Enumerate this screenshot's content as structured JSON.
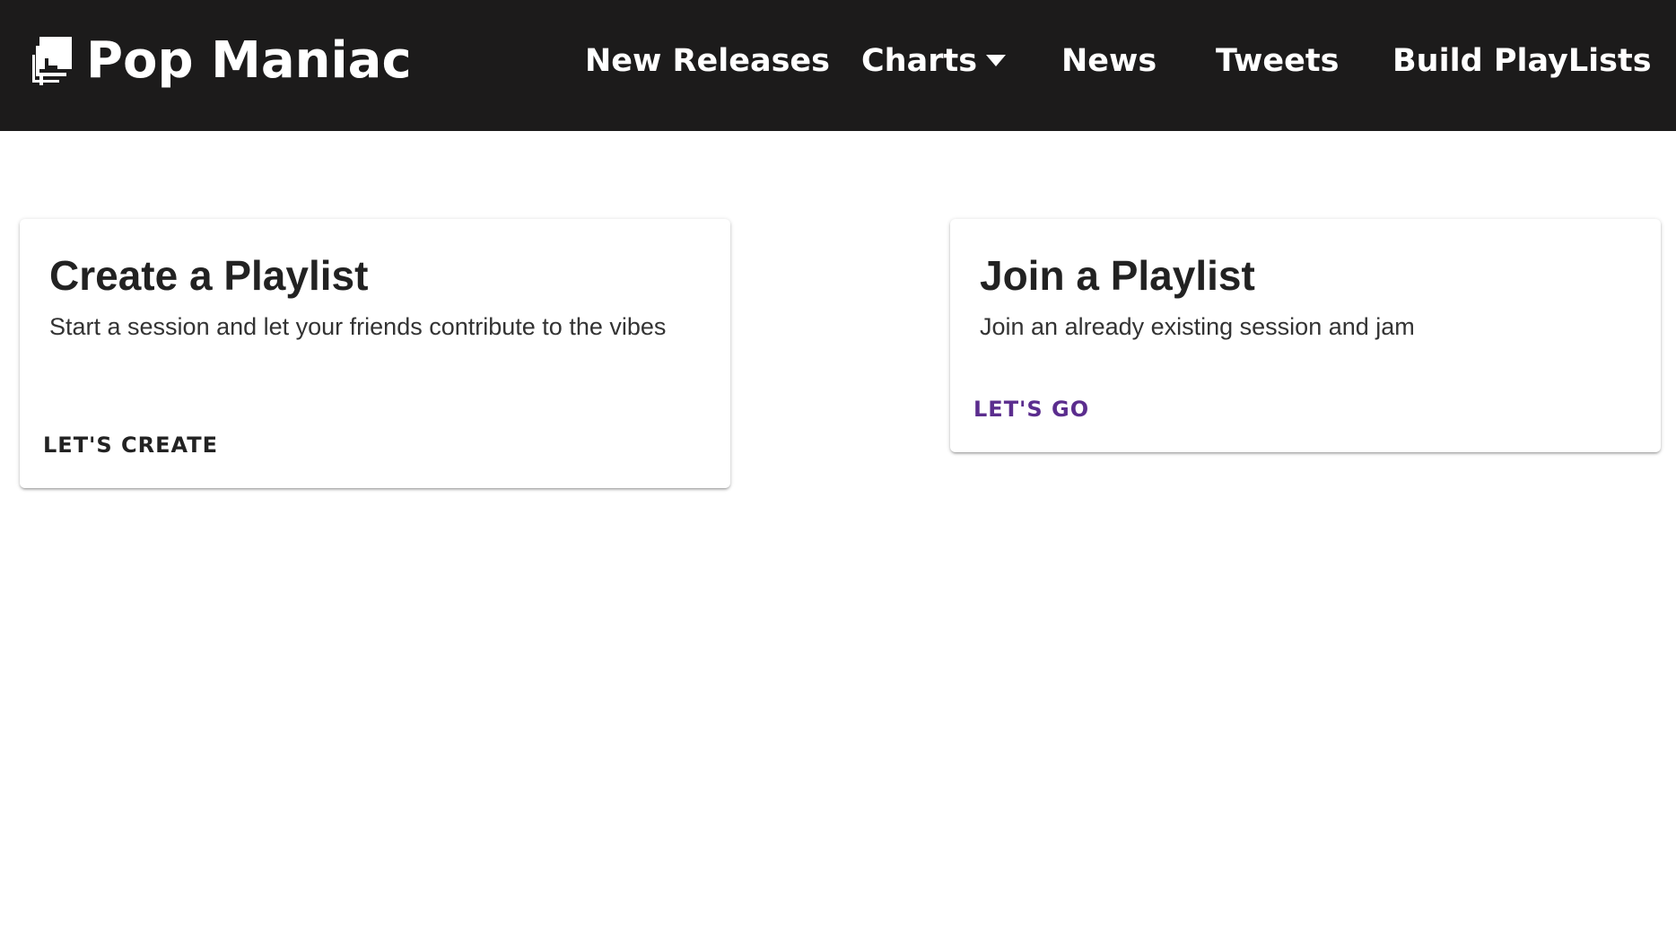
{
  "header": {
    "brand_name": "Pop Maniac",
    "brand_icon": "stacked-squares-logo-icon",
    "nav": {
      "new_releases": "New Releases",
      "charts": "Charts",
      "charts_icon": "caret-down-icon",
      "news": "News",
      "tweets": "Tweets",
      "build_playlists": "Build PlayLists"
    }
  },
  "cards": {
    "create": {
      "title": "Create a Playlist",
      "description": "Start a session and let your friends contribute to the vibes",
      "action": "Let's Create"
    },
    "join": {
      "title": "Join a Playlist",
      "description": "Join an already existing session and jam",
      "action": "Let's Go"
    }
  },
  "colors": {
    "navbar": "#1c1b1b",
    "nav_text": "#ffffff",
    "accent": "#5b2d8e",
    "background": "#ffffff"
  }
}
